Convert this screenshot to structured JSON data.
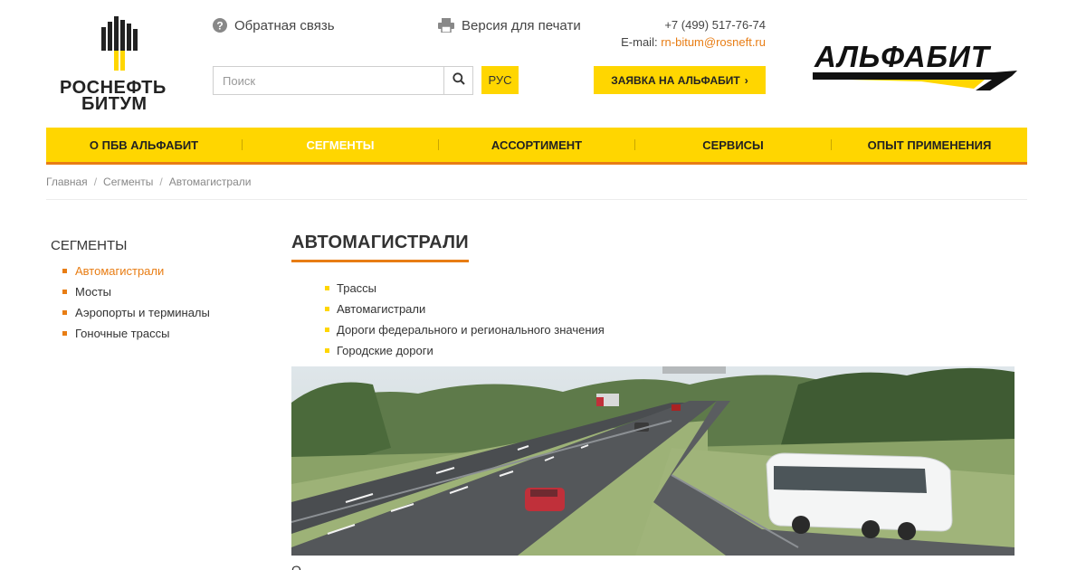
{
  "brand": {
    "rn_line1": "РОСНЕФТЬ",
    "rn_line2": "БИТУМ",
    "alfabit": "АЛЬФАБИТ",
    "colors": {
      "yellow": "#ffd600",
      "orange": "#e87d14",
      "dark": "#222222"
    }
  },
  "header": {
    "feedback": {
      "label": "Обратная связь",
      "icon": "question-circle-icon"
    },
    "print": {
      "label": "Версия для печати",
      "icon": "printer-icon"
    },
    "phone": "+7 (499) 517-76-74",
    "email_label": "E-mail:",
    "email": "rn-bitum@rosneft.ru",
    "search": {
      "placeholder": "Поиск",
      "value": "",
      "icon": "search-icon"
    },
    "lang": "РУС",
    "apply": {
      "label": "ЗАЯВКА НА АЛЬФАБИТ",
      "icon": "chevron-right-icon"
    }
  },
  "nav": {
    "items": [
      {
        "label": "О ПБВ АЛЬФАБИТ",
        "active": false
      },
      {
        "label": "СЕГМЕНТЫ",
        "active": true
      },
      {
        "label": "АССОРТИМЕНТ",
        "active": false
      },
      {
        "label": "СЕРВИСЫ",
        "active": false
      },
      {
        "label": "ОПЫТ ПРИМЕНЕНИЯ",
        "active": false
      }
    ]
  },
  "breadcrumb": [
    "Главная",
    "Сегменты",
    "Автомагистрали"
  ],
  "sidebar": {
    "title": "СЕГМЕНТЫ",
    "items": [
      {
        "label": "Автомагистрали",
        "active": true
      },
      {
        "label": "Мосты",
        "active": false
      },
      {
        "label": "Аэропорты и терминалы",
        "active": false
      },
      {
        "label": "Гоночные трассы",
        "active": false
      }
    ]
  },
  "main": {
    "title": "АВТОМАГИСТРАЛИ",
    "list": [
      "Трассы",
      "Автомагистрали",
      "Дороги федерального и регионального значения",
      "Городские дороги"
    ],
    "image": "highway-photo",
    "cut_text": "О"
  }
}
